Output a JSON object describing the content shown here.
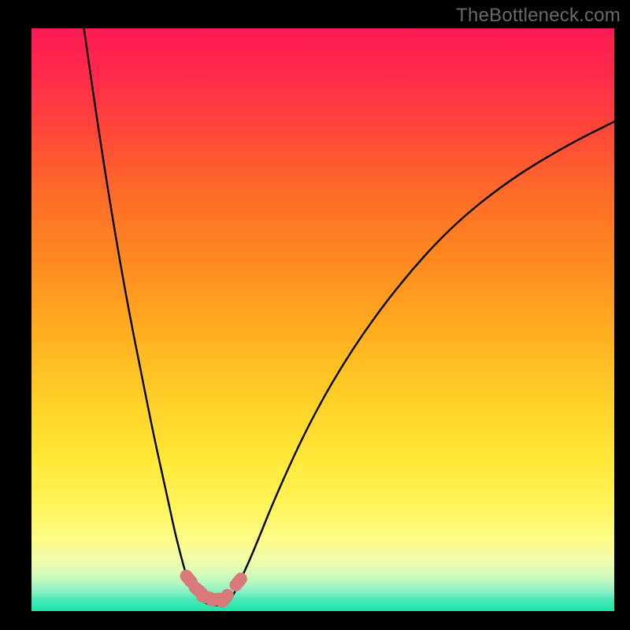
{
  "watermark": "TheBottleneck.com",
  "chart_data": {
    "type": "line",
    "title": "",
    "xlabel": "",
    "ylabel": "",
    "xlim": [
      0,
      100
    ],
    "ylim": [
      0,
      100
    ],
    "grid": false,
    "legend": false,
    "background": "rainbow-gradient-red-to-green",
    "series": [
      {
        "name": "left-branch",
        "x": [
          9,
          11,
          13,
          15,
          17,
          19,
          21,
          23,
          24.5,
          25.5,
          26.3,
          27,
          27.8,
          28.5,
          29.2
        ],
        "y": [
          100,
          86,
          73,
          61,
          50,
          40,
          30,
          21,
          14,
          10,
          7,
          5,
          3.6,
          2.6,
          1.9
        ]
      },
      {
        "name": "trough",
        "x": [
          29.2,
          30.2,
          31.3,
          32.4,
          33.4,
          34.2
        ],
        "y": [
          1.9,
          1.2,
          1.0,
          1.0,
          1.3,
          2.0
        ]
      },
      {
        "name": "right-branch",
        "x": [
          34.2,
          35.5,
          38,
          42,
          48,
          55,
          63,
          72,
          82,
          92,
          100
        ],
        "y": [
          2.0,
          4.5,
          10,
          20,
          33,
          45,
          56,
          66,
          74,
          80,
          84
        ]
      }
    ],
    "markers": {
      "name": "trough-points",
      "color": "#d97a7a",
      "points": [
        {
          "x": 27.0,
          "y": 5.5
        },
        {
          "x": 28.6,
          "y": 3.6
        },
        {
          "x": 30.0,
          "y": 2.4
        },
        {
          "x": 31.6,
          "y": 2.0
        },
        {
          "x": 33.2,
          "y": 2.2
        },
        {
          "x": 35.5,
          "y": 5.0
        }
      ]
    }
  }
}
